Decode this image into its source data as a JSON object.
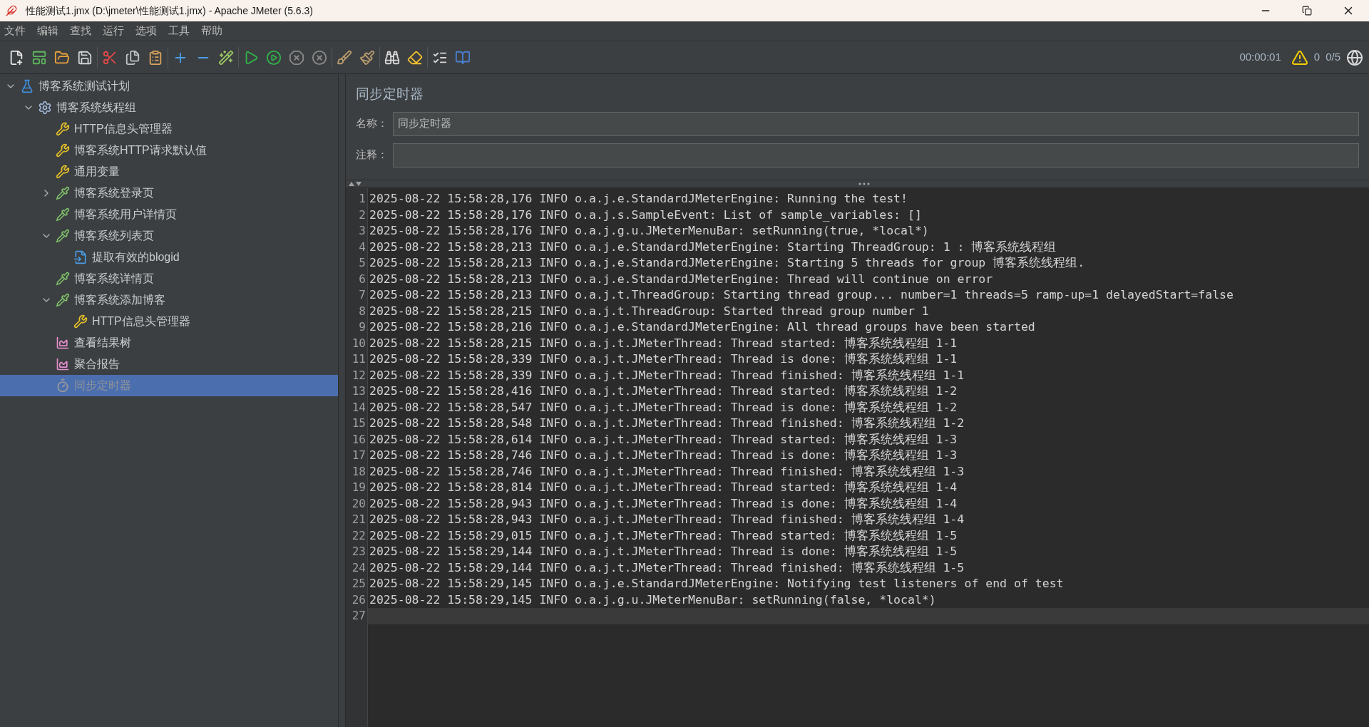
{
  "window": {
    "title": "性能测试1.jmx (D:\\jmeter\\性能测试1.jmx) - Apache JMeter (5.6.3)"
  },
  "menu": [
    "文件",
    "编辑",
    "查找",
    "运行",
    "选项",
    "工具",
    "帮助"
  ],
  "status": {
    "elapsed": "00:00:01",
    "warnings": "0",
    "threads": "0/5"
  },
  "tree": [
    {
      "label": "博客系统测试计划",
      "kind": "plan",
      "expanded": true,
      "selected": false,
      "disabled": false,
      "children": [
        {
          "label": "博客系统线程组",
          "kind": "threadgroup",
          "expanded": true,
          "selected": false,
          "disabled": false,
          "children": [
            {
              "label": "HTTP信息头管理器",
              "kind": "config",
              "selected": false,
              "disabled": false
            },
            {
              "label": "博客系统HTTP请求默认值",
              "kind": "config",
              "selected": false,
              "disabled": false
            },
            {
              "label": "通用变量",
              "kind": "config",
              "selected": false,
              "disabled": false
            },
            {
              "label": "博客系统登录页",
              "kind": "sampler",
              "expanded": false,
              "selected": false,
              "disabled": false
            },
            {
              "label": "博客系统用户详情页",
              "kind": "sampler",
              "selected": false,
              "disabled": false
            },
            {
              "label": "博客系统列表页",
              "kind": "sampler",
              "expanded": true,
              "selected": false,
              "disabled": false,
              "children": [
                {
                  "label": "提取有效的blogid",
                  "kind": "postprocessor",
                  "selected": false,
                  "disabled": false
                }
              ]
            },
            {
              "label": "博客系统详情页",
              "kind": "sampler",
              "selected": false,
              "disabled": false
            },
            {
              "label": "博客系统添加博客",
              "kind": "sampler",
              "expanded": true,
              "selected": false,
              "disabled": false,
              "children": [
                {
                  "label": "HTTP信息头管理器",
                  "kind": "config",
                  "selected": false,
                  "disabled": false
                }
              ]
            },
            {
              "label": "查看结果树",
              "kind": "listener",
              "selected": false,
              "disabled": false
            },
            {
              "label": "聚合报告",
              "kind": "listener",
              "selected": false,
              "disabled": false
            },
            {
              "label": "同步定时器",
              "kind": "timer",
              "selected": true,
              "disabled": true
            }
          ]
        }
      ]
    }
  ],
  "editor": {
    "title": "同步定时器",
    "fields": [
      {
        "label": "名称：",
        "value": "同步定时器"
      },
      {
        "label": "注释："
      }
    ]
  },
  "log": [
    {
      "number": "1",
      "text": "2025-08-22 15:58:28,176 INFO o.a.j.e.StandardJMeterEngine: Running the test!",
      "current": false
    },
    {
      "number": "2",
      "text": "2025-08-22 15:58:28,176 INFO o.a.j.s.SampleEvent: List of sample_variables: []",
      "current": false
    },
    {
      "number": "3",
      "text": "2025-08-22 15:58:28,176 INFO o.a.j.g.u.JMeterMenuBar: setRunning(true, *local*)",
      "current": false
    },
    {
      "number": "4",
      "text": "2025-08-22 15:58:28,213 INFO o.a.j.e.StandardJMeterEngine: Starting ThreadGroup: 1 : 博客系统线程组",
      "current": false
    },
    {
      "number": "5",
      "text": "2025-08-22 15:58:28,213 INFO o.a.j.e.StandardJMeterEngine: Starting 5 threads for group 博客系统线程组.",
      "current": false
    },
    {
      "number": "6",
      "text": "2025-08-22 15:58:28,213 INFO o.a.j.e.StandardJMeterEngine: Thread will continue on error",
      "current": false
    },
    {
      "number": "7",
      "text": "2025-08-22 15:58:28,213 INFO o.a.j.t.ThreadGroup: Starting thread group... number=1 threads=5 ramp-up=1 delayedStart=false",
      "current": false
    },
    {
      "number": "8",
      "text": "2025-08-22 15:58:28,215 INFO o.a.j.t.ThreadGroup: Started thread group number 1",
      "current": false
    },
    {
      "number": "9",
      "text": "2025-08-22 15:58:28,216 INFO o.a.j.e.StandardJMeterEngine: All thread groups have been started",
      "current": false
    },
    {
      "number": "10",
      "text": "2025-08-22 15:58:28,215 INFO o.a.j.t.JMeterThread: Thread started: 博客系统线程组 1-1",
      "current": false
    },
    {
      "number": "11",
      "text": "2025-08-22 15:58:28,339 INFO o.a.j.t.JMeterThread: Thread is done: 博客系统线程组 1-1",
      "current": false
    },
    {
      "number": "12",
      "text": "2025-08-22 15:58:28,339 INFO o.a.j.t.JMeterThread: Thread finished: 博客系统线程组 1-1",
      "current": false
    },
    {
      "number": "13",
      "text": "2025-08-22 15:58:28,416 INFO o.a.j.t.JMeterThread: Thread started: 博客系统线程组 1-2",
      "current": false
    },
    {
      "number": "14",
      "text": "2025-08-22 15:58:28,547 INFO o.a.j.t.JMeterThread: Thread is done: 博客系统线程组 1-2",
      "current": false
    },
    {
      "number": "15",
      "text": "2025-08-22 15:58:28,548 INFO o.a.j.t.JMeterThread: Thread finished: 博客系统线程组 1-2",
      "current": false
    },
    {
      "number": "16",
      "text": "2025-08-22 15:58:28,614 INFO o.a.j.t.JMeterThread: Thread started: 博客系统线程组 1-3",
      "current": false
    },
    {
      "number": "17",
      "text": "2025-08-22 15:58:28,746 INFO o.a.j.t.JMeterThread: Thread is done: 博客系统线程组 1-3",
      "current": false
    },
    {
      "number": "18",
      "text": "2025-08-22 15:58:28,746 INFO o.a.j.t.JMeterThread: Thread finished: 博客系统线程组 1-3",
      "current": false
    },
    {
      "number": "19",
      "text": "2025-08-22 15:58:28,814 INFO o.a.j.t.JMeterThread: Thread started: 博客系统线程组 1-4",
      "current": false
    },
    {
      "number": "20",
      "text": "2025-08-22 15:58:28,943 INFO o.a.j.t.JMeterThread: Thread is done: 博客系统线程组 1-4",
      "current": false
    },
    {
      "number": "21",
      "text": "2025-08-22 15:58:28,943 INFO o.a.j.t.JMeterThread: Thread finished: 博客系统线程组 1-4",
      "current": false
    },
    {
      "number": "22",
      "text": "2025-08-22 15:58:29,015 INFO o.a.j.t.JMeterThread: Thread started: 博客系统线程组 1-5",
      "current": false
    },
    {
      "number": "23",
      "text": "2025-08-22 15:58:29,144 INFO o.a.j.t.JMeterThread: Thread is done: 博客系统线程组 1-5",
      "current": false
    },
    {
      "number": "24",
      "text": "2025-08-22 15:58:29,144 INFO o.a.j.t.JMeterThread: Thread finished: 博客系统线程组 1-5",
      "current": false
    },
    {
      "number": "25",
      "text": "2025-08-22 15:58:29,145 INFO o.a.j.e.StandardJMeterEngine: Notifying test listeners of end of test",
      "current": false
    },
    {
      "number": "26",
      "text": "2025-08-22 15:58:29,145 INFO o.a.j.g.u.JMeterMenuBar: setRunning(false, *local*)",
      "current": false
    },
    {
      "number": "27",
      "current": true
    }
  ]
}
